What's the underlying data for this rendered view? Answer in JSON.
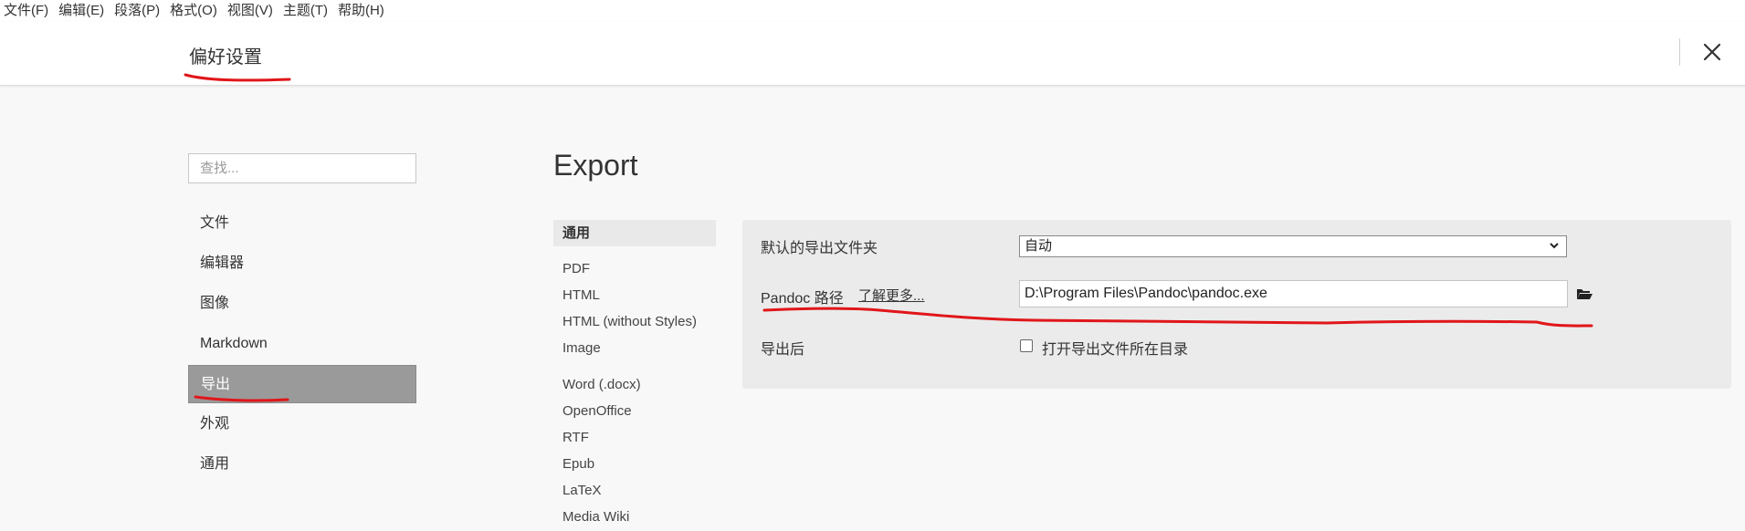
{
  "menubar": {
    "items": [
      "文件(F)",
      "编辑(E)",
      "段落(P)",
      "格式(O)",
      "视图(V)",
      "主题(T)",
      "帮助(H)"
    ]
  },
  "titlebar": {
    "title": "偏好设置",
    "close_icon": "close-icon"
  },
  "sidebar": {
    "search_placeholder": "查找...",
    "items": [
      {
        "label": "文件"
      },
      {
        "label": "编辑器"
      },
      {
        "label": "图像"
      },
      {
        "label": "Markdown"
      },
      {
        "label": "导出",
        "active": true
      },
      {
        "label": "外观"
      },
      {
        "label": "通用"
      }
    ]
  },
  "main": {
    "title": "Export",
    "subnav": {
      "items": [
        "通用",
        "PDF",
        "HTML",
        "HTML (without Styles)",
        "Image",
        "Word (.docx)",
        "OpenOffice",
        "RTF",
        "Epub",
        "LaTeX",
        "Media Wiki"
      ],
      "active": "通用"
    },
    "settings": {
      "default_folder_label": "默认的导出文件夹",
      "default_folder_value": "自动",
      "pandoc_label": "Pandoc 路径",
      "learn_more": "了解更多...",
      "pandoc_path": "D:\\Program Files\\Pandoc\\pandoc.exe",
      "after_export_label": "导出后",
      "open_folder_label": "打开导出文件所在目录",
      "open_folder_checked": false
    }
  },
  "colors": {
    "annotation_red": "#e0161a",
    "active_nav_bg": "#9a9a9a",
    "panel_bg": "#ebebeb"
  }
}
